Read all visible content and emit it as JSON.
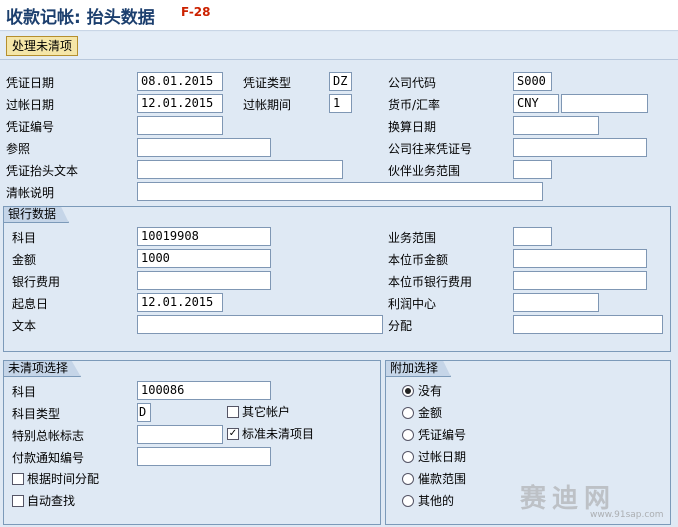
{
  "title": {
    "main": "收款记帐: 抬头数据",
    "code": "F-28"
  },
  "toolbar": {
    "process_open_items": "处理未清项"
  },
  "header": {
    "doc_date_label": "凭证日期",
    "doc_date": "08.01.2015",
    "doc_type_label": "凭证类型",
    "doc_type": "DZ",
    "company_code_label": "公司代码",
    "company_code": "S000",
    "posting_date_label": "过帐日期",
    "posting_date": "12.01.2015",
    "period_label": "过帐期间",
    "period": "1",
    "currency_label": "货币/汇率",
    "currency": "CNY",
    "rate": "",
    "doc_number_label": "凭证编号",
    "doc_number": "",
    "translation_date_label": "换算日期",
    "translation_date": "",
    "reference_label": "参照",
    "reference": "",
    "intercompany_label": "公司往来凭证号",
    "intercompany": "",
    "header_text_label": "凭证抬头文本",
    "header_text": "",
    "partner_ba_label": "伙伴业务范围",
    "partner_ba": "",
    "clearing_text_label": "清帐说明",
    "clearing_text": ""
  },
  "bank": {
    "title": "银行数据",
    "account_label": "科目",
    "account": "10019908",
    "amount_label": "金额",
    "amount": "1000",
    "bank_charges_label": "银行费用",
    "bank_charges": "",
    "value_date_label": "起息日",
    "value_date": "12.01.2015",
    "text_label": "文本",
    "text": "",
    "business_area_label": "业务范围",
    "business_area": "",
    "lc_amount_label": "本位币金额",
    "lc_amount": "",
    "lc_bank_charges_label": "本位币银行费用",
    "lc_bank_charges": "",
    "profit_center_label": "利润中心",
    "profit_center": "",
    "assignment_label": "分配",
    "assignment": ""
  },
  "open_items": {
    "title": "未清项选择",
    "account_label": "科目",
    "account": "100086",
    "account_type_label": "科目类型",
    "account_type": "D",
    "other_accounts_label": "其它帐户",
    "other_accounts_checked": false,
    "special_gl_label": "特别总帐标志",
    "special_gl": "",
    "standard_oi_label": "标准未清项目",
    "standard_oi_checked": true,
    "payment_advice_label": "付款通知编号",
    "payment_advice": "",
    "distribute_by_age_label": "根据时间分配",
    "distribute_by_age_checked": false,
    "auto_search_label": "自动查找",
    "auto_search_checked": false,
    "check_mark": "✓"
  },
  "additional": {
    "title": "附加选择",
    "options": [
      {
        "label": "没有",
        "selected": true
      },
      {
        "label": "金额",
        "selected": false
      },
      {
        "label": "凭证编号",
        "selected": false
      },
      {
        "label": "过帐日期",
        "selected": false
      },
      {
        "label": "催款范围",
        "selected": false
      },
      {
        "label": "其他的",
        "selected": false
      }
    ]
  },
  "watermark": {
    "text": "赛迪网",
    "url": "www.91sap.com"
  }
}
